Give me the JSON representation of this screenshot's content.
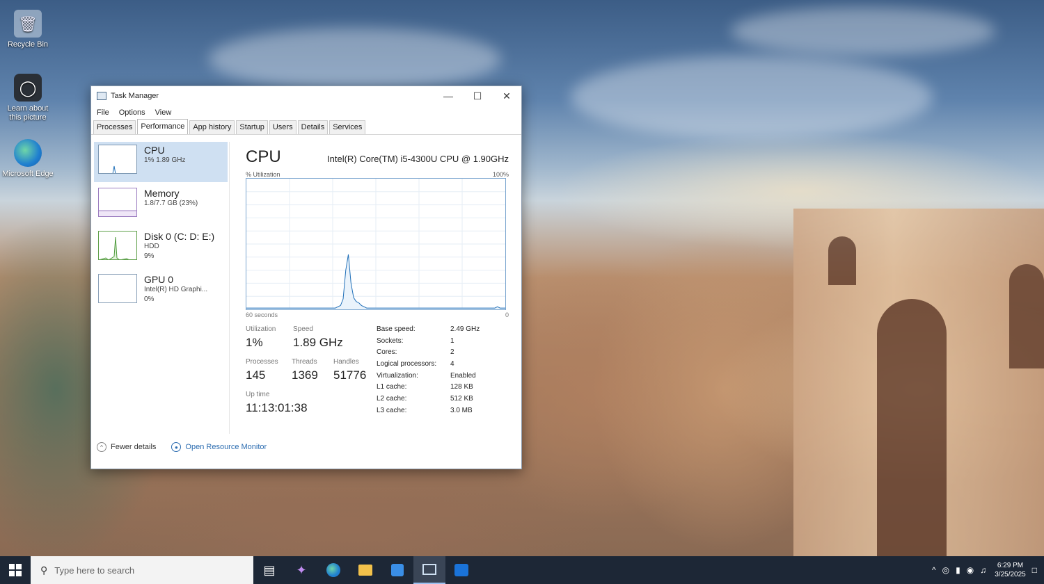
{
  "desktop": {
    "icons": [
      {
        "label": "Recycle Bin",
        "icon": "recycle-bin-icon"
      },
      {
        "label": "Learn about this picture",
        "icon": "camera-icon"
      },
      {
        "label": "Microsoft Edge",
        "icon": "edge-icon"
      }
    ]
  },
  "window": {
    "title": "Task Manager",
    "controls": {
      "minimize": "—",
      "maximize": "☐",
      "close": "✕"
    },
    "menu": [
      "File",
      "Options",
      "View"
    ],
    "tabs": [
      "Processes",
      "Performance",
      "App history",
      "Startup",
      "Users",
      "Details",
      "Services"
    ],
    "active_tab": "Performance"
  },
  "sidebar": {
    "items": [
      {
        "name": "CPU",
        "line1": "1% 1.89 GHz",
        "line2": ""
      },
      {
        "name": "Memory",
        "line1": "1.8/7.7 GB (23%)",
        "line2": ""
      },
      {
        "name": "Disk 0 (C: D: E:)",
        "line1": "HDD",
        "line2": "9%"
      },
      {
        "name": "GPU 0",
        "line1": "Intel(R) HD Graphi...",
        "line2": "0%"
      }
    ]
  },
  "main": {
    "title": "CPU",
    "model": "Intel(R) Core(TM) i5-4300U CPU @ 1.90GHz",
    "graph_label_left": "% Utilization",
    "graph_label_right": "100%",
    "graph_foot_left": "60 seconds",
    "graph_foot_right": "0",
    "utilization": {
      "label": "Utilization",
      "value": "1%"
    },
    "speed": {
      "label": "Speed",
      "value": "1.89 GHz"
    },
    "processes": {
      "label": "Processes",
      "value": "145"
    },
    "threads": {
      "label": "Threads",
      "value": "1369"
    },
    "handles": {
      "label": "Handles",
      "value": "51776"
    },
    "uptime": {
      "label": "Up time",
      "value": "11:13:01:38"
    },
    "specs": [
      {
        "k": "Base speed:",
        "v": "2.49 GHz"
      },
      {
        "k": "Sockets:",
        "v": "1"
      },
      {
        "k": "Cores:",
        "v": "2"
      },
      {
        "k": "Logical processors:",
        "v": "4"
      },
      {
        "k": "Virtualization:",
        "v": "Enabled"
      },
      {
        "k": "L1 cache:",
        "v": "128 KB"
      },
      {
        "k": "L2 cache:",
        "v": "512 KB"
      },
      {
        "k": "L3 cache:",
        "v": "3.0 MB"
      }
    ],
    "cpu_history": [
      1,
      1,
      1,
      1,
      1,
      1,
      1,
      1,
      1,
      1,
      1,
      1,
      1,
      1,
      1,
      1,
      1,
      1,
      1,
      1,
      1,
      1,
      1,
      1,
      1,
      1,
      1,
      1,
      1,
      1,
      1,
      1,
      1,
      1,
      1,
      2,
      3,
      8,
      30,
      42,
      20,
      9,
      6,
      5,
      3,
      2,
      1,
      1,
      1,
      1,
      1,
      1,
      1,
      1,
      1,
      1,
      1,
      1,
      1,
      1,
      1,
      1,
      1,
      1,
      1,
      1,
      1,
      1,
      1,
      1,
      1,
      1,
      1,
      1,
      1,
      1,
      1,
      1,
      1,
      1,
      1,
      1,
      1,
      1,
      1,
      1,
      1,
      1,
      1,
      1,
      1,
      1,
      1,
      1,
      1,
      1,
      2,
      1,
      1,
      1
    ]
  },
  "footer": {
    "fewer_details": "Fewer details",
    "resource_monitor": "Open Resource Monitor"
  },
  "taskbar": {
    "search_placeholder": "Type here to search",
    "icons": [
      "task-view-icon",
      "copilot-icon",
      "edge-icon",
      "file-explorer-icon",
      "store-icon",
      "task-manager-icon",
      "outlook-icon"
    ],
    "clock_time": "6:29 PM",
    "clock_date": "3/25/2025"
  }
}
